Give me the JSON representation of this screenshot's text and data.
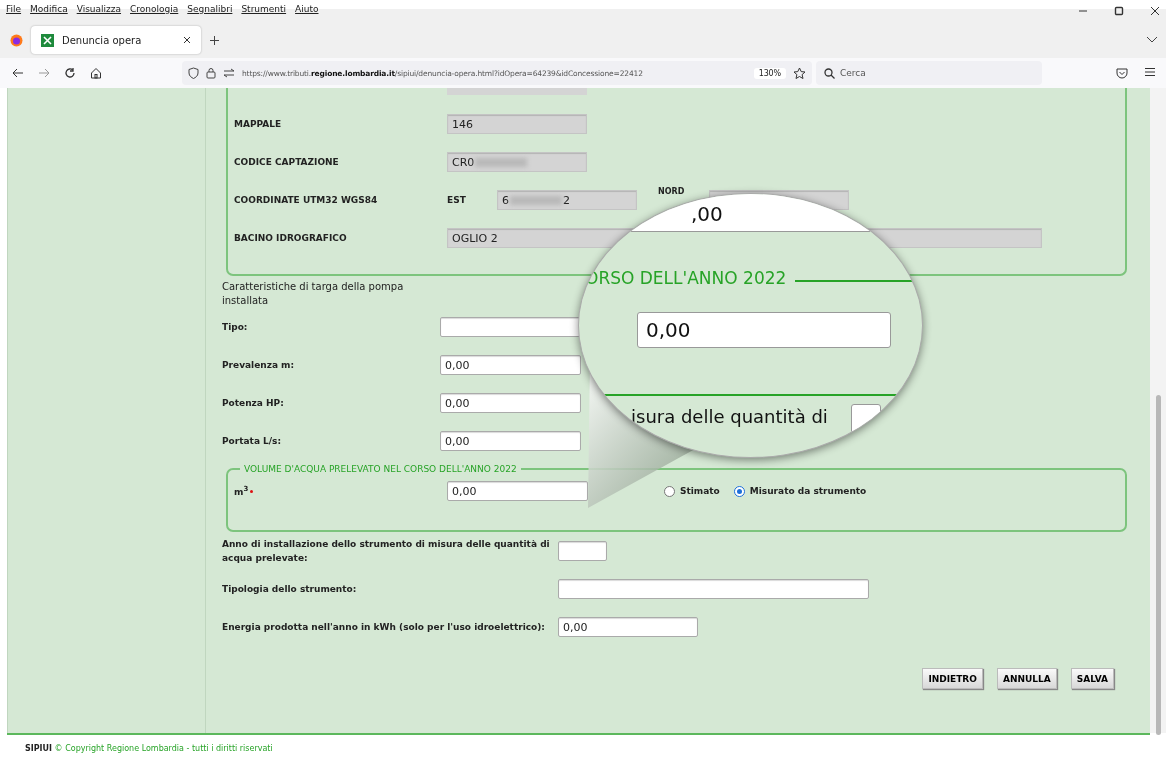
{
  "browser": {
    "menu": [
      "File",
      "Modifica",
      "Visualizza",
      "Cronologia",
      "Segnalibri",
      "Strumenti",
      "Aiuto"
    ],
    "tabs": [
      {
        "title": "Denuncia opera",
        "selected": true
      }
    ],
    "url": "https://www.tributi.**regione.lombardia.it**/sipiui/denuncia-opera.html?idOpera=64239&idConcessione=22412",
    "zoom": "130%",
    "search": {
      "placeholder": "Cerca"
    }
  },
  "location_fieldset": {
    "rows": [
      {
        "label": "MAPPALE",
        "value": "146"
      },
      {
        "label": "CODICE CAPTAZIONE",
        "value": "CR0",
        "redacted": true
      },
      {
        "label": "BACINO IDROGRAFICO",
        "value": "OGLIO 2",
        "wide": true
      }
    ],
    "coordinates": {
      "label": "COORDINATE UTM32 WGS84",
      "est_label": "EST",
      "est_value_start": "6",
      "est_value_end": "2",
      "nord_label": "NORD"
    }
  },
  "pump": {
    "title": "Caratteristiche di targa della pompa installata",
    "fields": [
      {
        "label": "Tipo:"
      },
      {
        "label": "Prevalenza m:",
        "value": "0,00"
      },
      {
        "label": "Potenza HP:",
        "value": "0,00"
      },
      {
        "label": "Portata L/s:",
        "value": "0,00"
      }
    ]
  },
  "volume": {
    "legend": "VOLUME D'ACQUA PRELEVATO NEL CORSO DELL'ANNO 2022",
    "label": "m$^{3}$",
    "required": true,
    "value": "0,00",
    "options": [
      {
        "label": "Stimato",
        "selected": false
      },
      {
        "label": "Misurato da strumento",
        "selected": true
      }
    ]
  },
  "instrument": {
    "fields": [
      {
        "label": "Anno di installazione dello strumento di misura delle quantità di acqua prelevate:",
        "kind": "short"
      },
      {
        "label": "Tipologia dello strumento:",
        "kind": "long"
      },
      {
        "label": "Energia prodotta nell'anno in kWh (solo per l'uso idroelettrico):",
        "value": "0,00",
        "kind": "medium"
      }
    ]
  },
  "buttons": [
    "INDIETRO",
    "ANNULLA",
    "SALVA"
  ],
  "magnifier": {
    "top_value": ",00",
    "legend": "ORSO DELL'ANNO 2022",
    "value": "0,00",
    "text": "isura delle quantità di"
  },
  "footer": "**SIPIUI** © Copyright Regione Lombardia - tutti i diritti riservati"
}
